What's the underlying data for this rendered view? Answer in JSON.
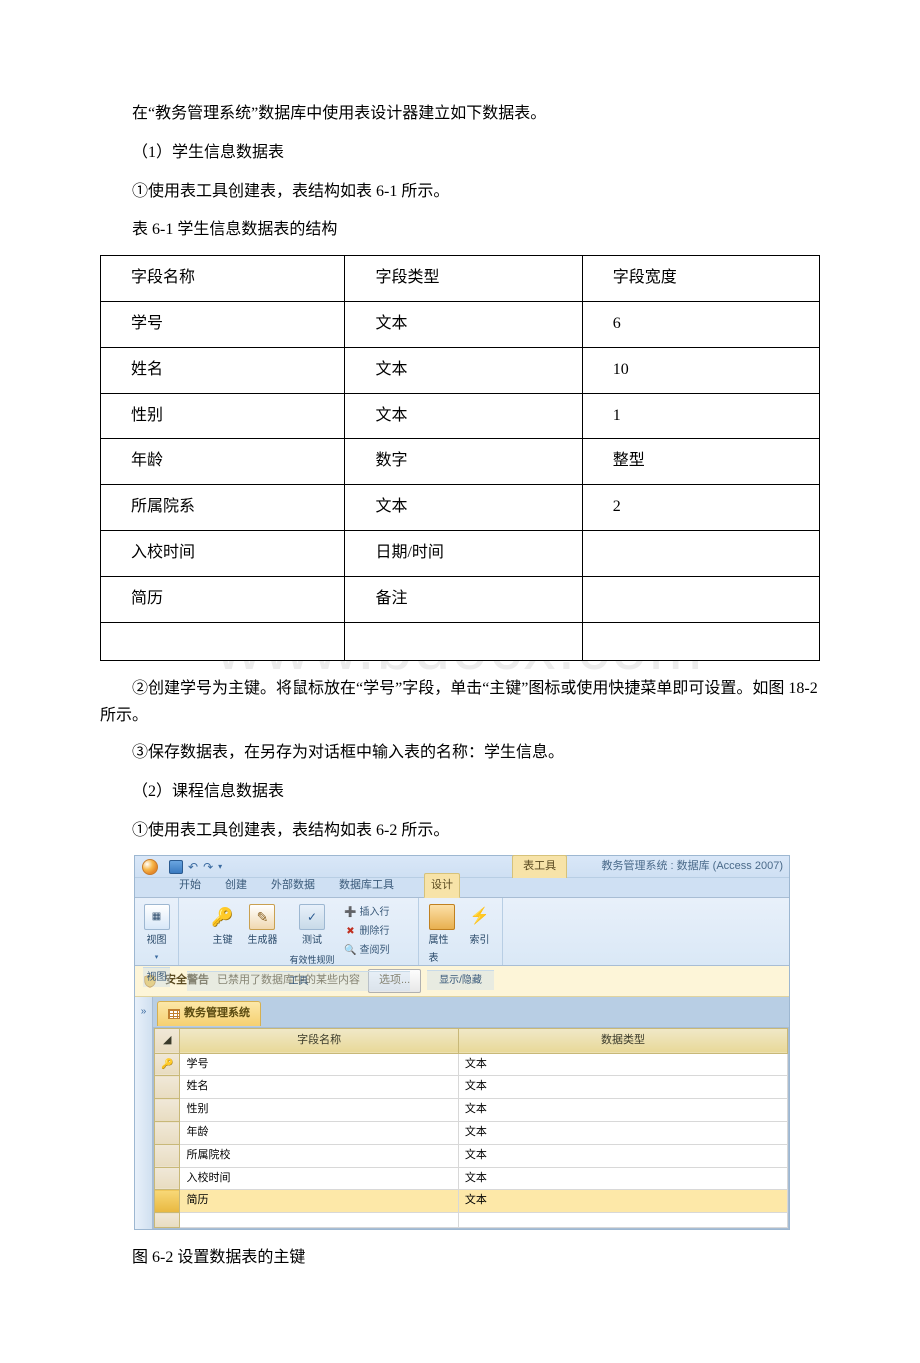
{
  "watermark": "www.bdocx.com",
  "intro": "在“教务管理系统”数据库中使用表设计器建立如下数据表。",
  "section1": {
    "heading": "（1）学生信息数据表",
    "step1": "①使用表工具创建表，表结构如表 6-1 所示。",
    "tableCaption": "表 6-1 学生信息数据表的结构",
    "headers": {
      "c1": "字段名称",
      "c2": "字段类型",
      "c3": "字段宽度"
    },
    "rows": [
      {
        "c1": "学号",
        "c2": "文本",
        "c3": "6"
      },
      {
        "c1": "姓名",
        "c2": "文本",
        "c3": "10"
      },
      {
        "c1": "性别",
        "c2": "文本",
        "c3": "1"
      },
      {
        "c1": "年龄",
        "c2": "数字",
        "c3": "整型"
      },
      {
        "c1": "所属院系",
        "c2": "文本",
        "c3": "2"
      },
      {
        "c1": "入校时间",
        "c2": "日期/时间",
        "c3": ""
      },
      {
        "c1": "简历",
        "c2": "备注",
        "c3": ""
      },
      {
        "c1": "",
        "c2": "",
        "c3": ""
      }
    ],
    "step2": "②创建学号为主键。将鼠标放在“学号”字段，单击“主键”图标或使用快捷菜单即可设置。如图 18-2 所示。",
    "step3": "③保存数据表，在另存为对话框中输入表的名称：学生信息。"
  },
  "section2": {
    "heading": "（2）课程信息数据表",
    "step1": "①使用表工具创建表，表结构如表 6-2 所示。"
  },
  "access": {
    "contextualTab": "表工具",
    "appTitle": "教务管理系统 : 数据库 (Access 2007)",
    "tabs": {
      "home": "开始",
      "create": "创建",
      "external": "外部数据",
      "dbtools": "数据库工具",
      "design": "设计"
    },
    "groups": {
      "view": "视图",
      "tools": "工具",
      "showhide": "显示/隐藏"
    },
    "buttons": {
      "view": "视图",
      "pk": "主键",
      "builder": "生成器",
      "test": "测试",
      "validation": "有效性规则",
      "insertRow": "插入行",
      "deleteRow": "删除行",
      "lookup": "查阅列",
      "propSheet": "属性表",
      "indexes": "索引"
    },
    "msgbar": {
      "label": "安全警告",
      "text": "已禁用了数据库中的某些内容",
      "options": "选项..."
    },
    "navCollapse": "»",
    "docTab": "教务管理系统",
    "gridHeaders": {
      "name": "字段名称",
      "type": "数据类型"
    },
    "gridRows": [
      {
        "key": true,
        "name": "学号",
        "type": "文本"
      },
      {
        "key": false,
        "name": "姓名",
        "type": "文本"
      },
      {
        "key": false,
        "name": "性别",
        "type": "文本"
      },
      {
        "key": false,
        "name": "年龄",
        "type": "文本"
      },
      {
        "key": false,
        "name": "所属院校",
        "type": "文本"
      },
      {
        "key": false,
        "name": "入校时间",
        "type": "文本"
      },
      {
        "key": false,
        "name": "简历",
        "type": "文本",
        "selected": true
      }
    ]
  },
  "figureCaption": "图 6-2 设置数据表的主键"
}
